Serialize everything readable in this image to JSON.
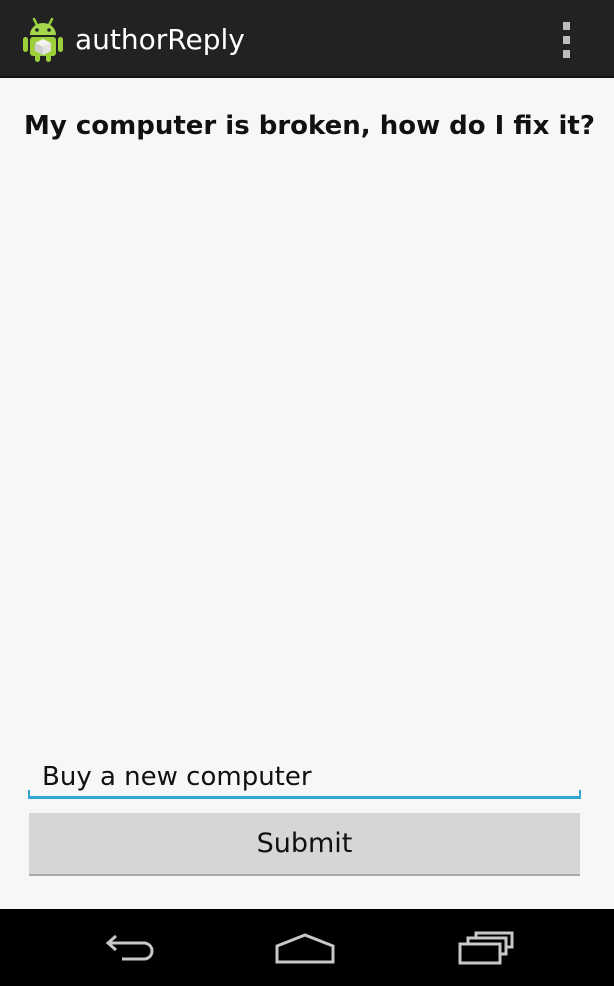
{
  "app": {
    "title": "authorReply",
    "icon": "android-robot-icon",
    "overflow_icon": "overflow-menu-icon"
  },
  "content": {
    "question": "My computer is broken, how do I fix it?",
    "answer_value": "Buy a new computer",
    "submit_label": "Submit"
  },
  "nav": {
    "back_icon": "back-icon",
    "home_icon": "home-icon",
    "recents_icon": "recent-apps-icon"
  },
  "colors": {
    "action_bar": "#222222",
    "accent": "#33a5d4",
    "button": "#d6d6d6",
    "nav_bar": "#000000"
  }
}
